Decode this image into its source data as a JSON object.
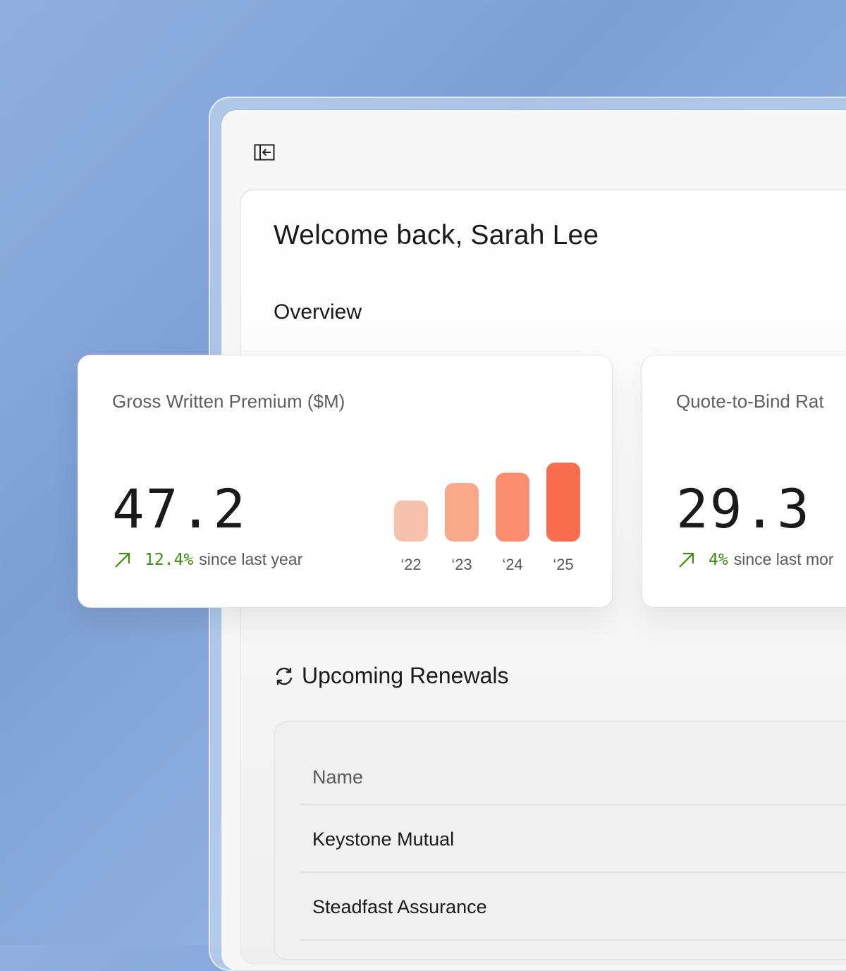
{
  "header": {
    "sidebar_toggle_icon": "sidebar-collapse-icon"
  },
  "welcome": {
    "title": "Welcome back, Sarah Lee"
  },
  "overview": {
    "heading": "Overview",
    "cards": [
      {
        "title": "Gross Written Premium ($M)",
        "value": "47.2",
        "change_value": "12.4%",
        "change_text": "since last year",
        "trend_icon": "arrow-up-right-icon"
      },
      {
        "title": "Quote-to-Bind Rat",
        "value": "29.3",
        "change_value": "4%",
        "change_text": "since last mor",
        "trend_icon": "arrow-up-right-icon"
      }
    ]
  },
  "chart_data": {
    "type": "bar",
    "categories": [
      "‘22",
      "‘23",
      "‘24",
      "‘25"
    ],
    "values": [
      0.52,
      0.74,
      0.87,
      1.0
    ],
    "colors": [
      "#f7c2ab",
      "#f9a889",
      "#fb8e6e",
      "#f96c4e"
    ],
    "title": "",
    "xlabel": "",
    "ylabel": ""
  },
  "renewals": {
    "heading": "Upcoming Renewals",
    "icon": "refresh-icon",
    "columns": [
      "Name"
    ],
    "rows": [
      {
        "name": "Keystone Mutual"
      },
      {
        "name": "Steadfast Assurance"
      }
    ]
  },
  "colors": {
    "positive": "#3d8b12",
    "background": "#8fb0e0"
  }
}
